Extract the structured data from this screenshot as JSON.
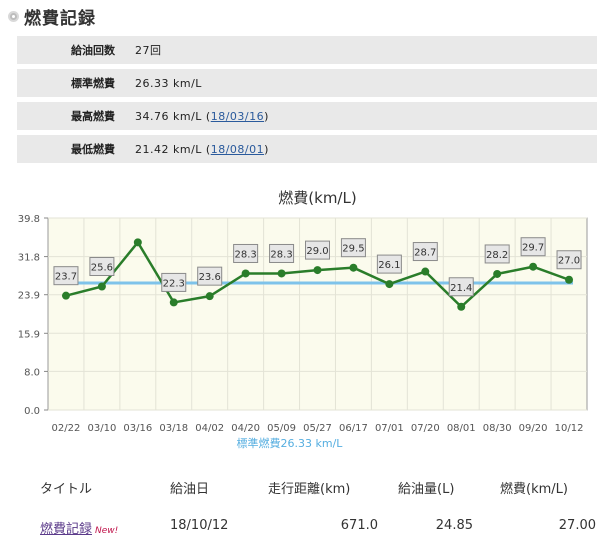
{
  "heading": {
    "title": "燃費記録"
  },
  "stats": [
    {
      "label": "給油回数",
      "value": "27回"
    },
    {
      "label": "標準燃費",
      "value": "26.33 km/L"
    },
    {
      "label": "最高燃費",
      "value": "34.76 km/L (",
      "date": "18/03/16",
      "close": ")"
    },
    {
      "label": "最低燃費",
      "value": "21.42 km/L (",
      "date": "18/08/01",
      "close": ")"
    }
  ],
  "chart_data": {
    "type": "line",
    "title": "燃費(km/L)",
    "categories": [
      "02/22",
      "03/10",
      "03/16",
      "03/18",
      "04/02",
      "04/20",
      "05/09",
      "05/27",
      "06/17",
      "07/01",
      "07/20",
      "08/01",
      "08/30",
      "09/20",
      "10/12"
    ],
    "values": [
      23.7,
      25.6,
      34.76,
      22.3,
      23.6,
      28.3,
      28.3,
      29.0,
      29.5,
      26.1,
      28.7,
      21.4,
      28.2,
      29.7,
      27.0
    ],
    "data_labels": [
      "23.7",
      "25.6",
      "",
      "22.3",
      "23.6",
      "28.3",
      "28.3",
      "29.0",
      "29.5",
      "26.1",
      "28.7",
      "21.4",
      "28.2",
      "29.7",
      "27.0"
    ],
    "yticks": [
      "0.0",
      "8.0",
      "15.9",
      "23.9",
      "31.8",
      "39.8"
    ],
    "ylim": [
      0,
      39.8
    ],
    "reference": {
      "value": 26.33,
      "label": "標準燃費26.33 km/L"
    },
    "grid": true,
    "colors": {
      "line": "#2a7d2a",
      "reference": "#7ec3ea",
      "background": "#fbfbed"
    }
  },
  "log": {
    "headers": [
      "タイトル",
      "給油日",
      "走行距離(km)",
      "給油量(L)",
      "燃費(km/L)"
    ],
    "rows": [
      {
        "title": "燃費記録",
        "badge": "New!",
        "date": "18/10/12",
        "distance": "671.0",
        "fuel": "24.85",
        "efficiency": "27.00"
      }
    ]
  }
}
